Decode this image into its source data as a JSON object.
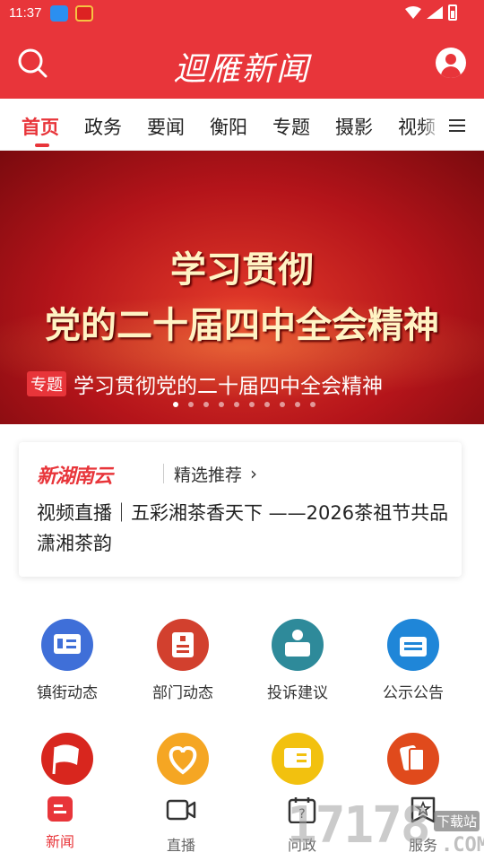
{
  "status_bar": {
    "time": "11:37"
  },
  "header": {
    "title": "迴雁新闻"
  },
  "tabs": [
    {
      "label": "首页",
      "active": true
    },
    {
      "label": "政务"
    },
    {
      "label": "要闻"
    },
    {
      "label": "衡阳"
    },
    {
      "label": "专题"
    },
    {
      "label": "摄影"
    },
    {
      "label": "视频"
    }
  ],
  "banner": {
    "line1": "学习贯彻",
    "line2": "党的二十届四中全会精神",
    "tag": "专题",
    "caption": "学习贯彻党的二十届四中全会精神",
    "dot_count": 10,
    "active_dot": 0
  },
  "recommend": {
    "logo": "新湖南云",
    "label": "精选推荐",
    "chevron": "›",
    "headline": "视频直播｜五彩湘茶香天下 ——2026茶祖节共品潇湘茶韵"
  },
  "services": [
    {
      "label": "镇街动态",
      "icon": "news-card-icon",
      "color": "#3f6fd8"
    },
    {
      "label": "部门动态",
      "icon": "clipboard-star-icon",
      "color": "#d2402e"
    },
    {
      "label": "投诉建议",
      "icon": "complaint-person-icon",
      "color": "#2e8a9a"
    },
    {
      "label": "公示公告",
      "icon": "notice-board-icon",
      "color": "#1f86d8"
    },
    {
      "label": "",
      "icon": "party-flag-icon",
      "color": "#d8261e"
    },
    {
      "label": "",
      "icon": "heart-icon",
      "color": "#f5a623"
    },
    {
      "label": "",
      "icon": "party-newspaper-icon",
      "color": "#f2c10f"
    },
    {
      "label": "",
      "icon": "cards-icon",
      "color": "#e04a1c"
    }
  ],
  "bottom_nav": [
    {
      "label": "新闻",
      "icon": "news-tab-icon",
      "active": true
    },
    {
      "label": "直播",
      "icon": "video-camera-icon"
    },
    {
      "label": "问政",
      "icon": "question-calendar-icon"
    },
    {
      "label": "服务",
      "icon": "service-badge-icon"
    }
  ],
  "watermark": {
    "big": "17178",
    "small": "下载站",
    "suffix": ".COM"
  },
  "colors": {
    "brand_red": "#e8353a",
    "banner_text": "#fff3c4"
  }
}
